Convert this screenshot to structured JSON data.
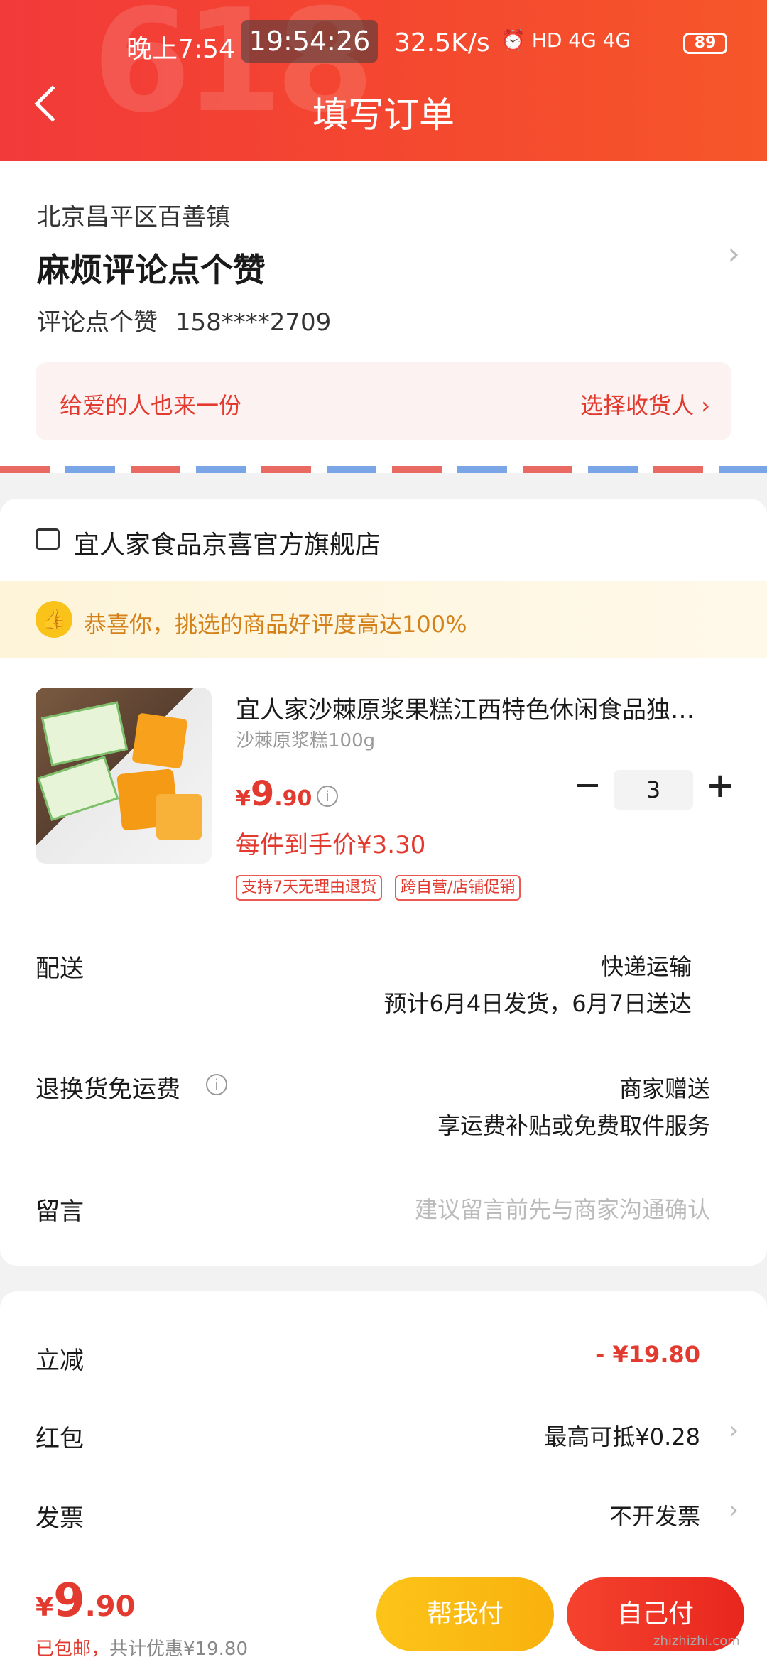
{
  "status_bar": {
    "time12": "晚上7:54",
    "clock": "19:54:26",
    "speed": "32.5K/s",
    "icons": "⏰ HD 4G 4G",
    "battery": "89"
  },
  "header": {
    "title": "填写订单",
    "deco": "618"
  },
  "address": {
    "region": "北京昌平区百善镇",
    "name": "麻烦评论点个赞",
    "recipient": "评论点个赞",
    "phone": "158****2709",
    "gift_text": "给爱的人也来一份",
    "gift_action": "选择收货人 ›"
  },
  "store": {
    "name": "宜人家食品京喜官方旗舰店",
    "praise": "恭喜你，挑选的商品好评度高达100%",
    "product": {
      "title": "宜人家沙棘原浆果糕江西特色休闲食品独…",
      "spec": "沙棘原浆糕100g",
      "price_currency": "¥",
      "price_int": "9",
      "price_dec": ".90",
      "quantity": "3",
      "each_price": "每件到手价¥3.30",
      "tags": [
        "支持7天无理由退货",
        "跨自营/店铺促销"
      ]
    },
    "delivery": {
      "label": "配送",
      "method": "快递运输",
      "eta": "预计6月4日发货，6月7日送达"
    },
    "return": {
      "label": "退换货免运费",
      "value": "商家赠送",
      "desc": "享运费补贴或免费取件服务"
    },
    "message": {
      "label": "留言",
      "placeholder": "建议留言前先与商家沟通确认"
    }
  },
  "summary": {
    "discount_label": "立减",
    "discount_value": "- ¥19.80",
    "redpacket_label": "红包",
    "redpacket_value": "最高可抵¥0.28",
    "invoice_label": "发票",
    "invoice_value": "不开发票"
  },
  "bottom": {
    "total_currency": "¥",
    "total_int": "9",
    "total_dec": ".90",
    "shipping_note": "已包邮，",
    "savings_note": "共计优惠¥19.80",
    "help_pay": "帮我付",
    "self_pay": "自己付"
  },
  "watermark": "zhizhizhi.com",
  "colors": {
    "header_red": "#f23a3a",
    "price_red": "#e23a2e",
    "help_yellow": "#fcc419",
    "praise_orange": "#d4811a"
  }
}
